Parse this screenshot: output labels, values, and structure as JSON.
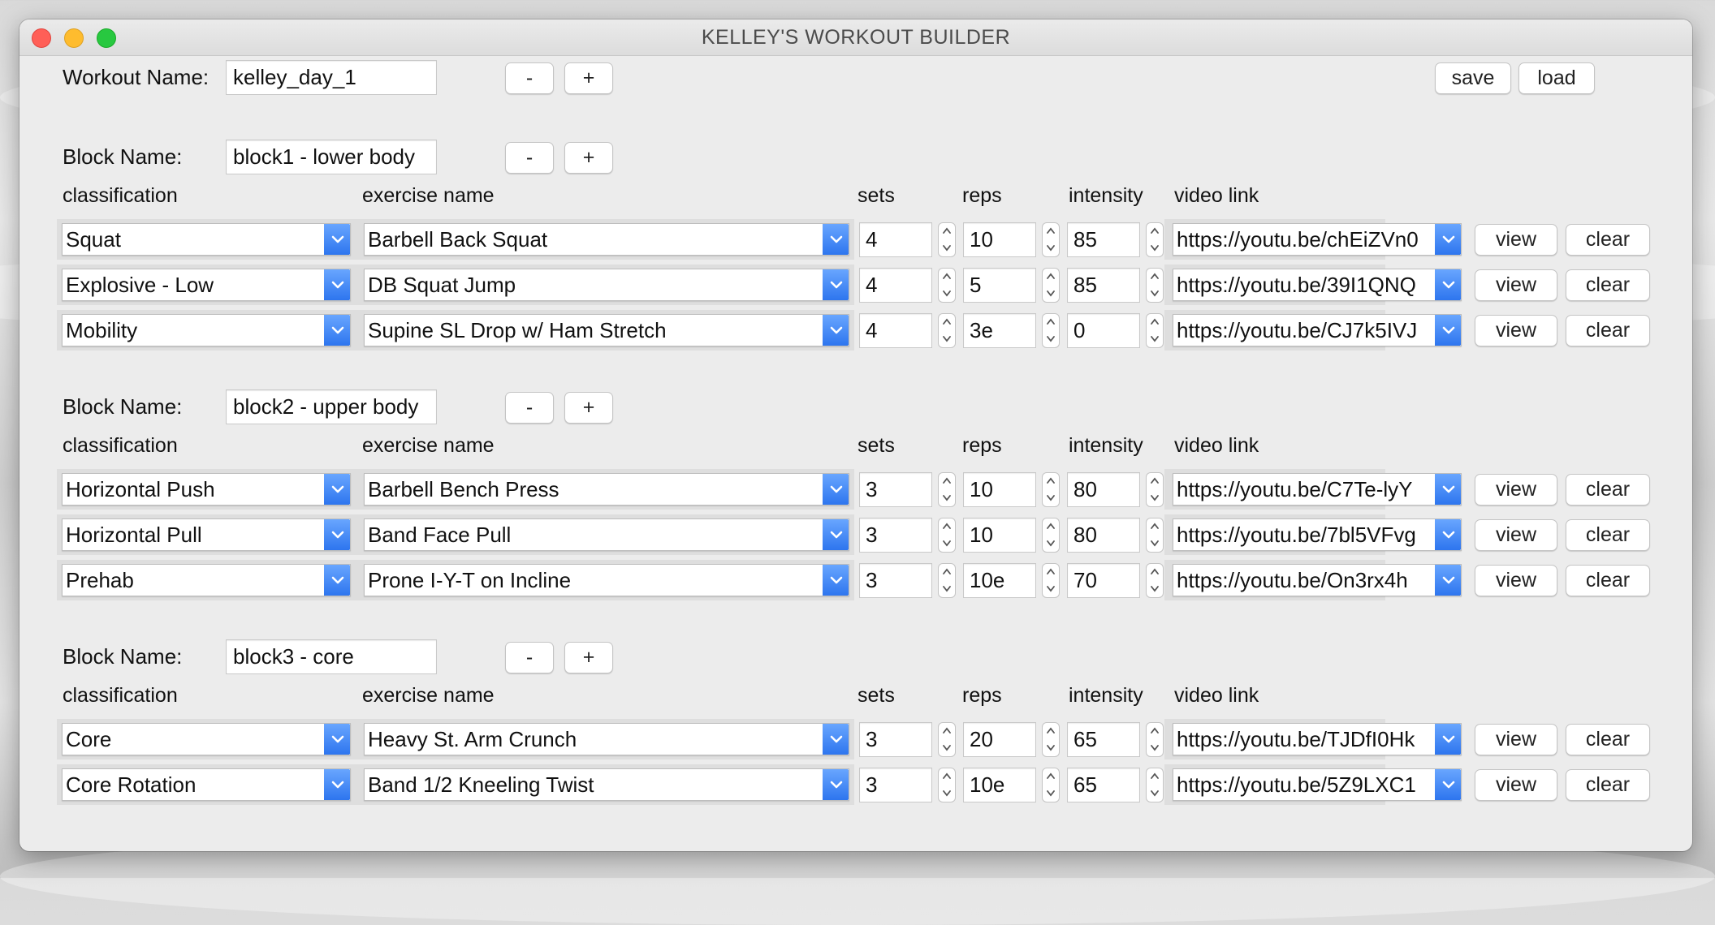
{
  "window": {
    "title": "KELLEY'S WORKOUT BUILDER"
  },
  "workout": {
    "label": "Workout Name:",
    "value": "kelley_day_1",
    "minus": "-",
    "plus": "+",
    "save": "save",
    "load": "load"
  },
  "columns": {
    "classification": "classification",
    "exercise": "exercise name",
    "sets": "sets",
    "reps": "reps",
    "intensity": "intensity",
    "video": "video link"
  },
  "row_buttons": {
    "view": "view",
    "clear": "clear"
  },
  "blocks": [
    {
      "label": "Block Name:",
      "name": "block1 - lower body",
      "minus": "-",
      "plus": "+",
      "rows": [
        {
          "classification": "Squat",
          "exercise": "Barbell Back Squat",
          "sets": "4",
          "reps": "10",
          "intensity": "85",
          "video": "https://youtu.be/chEiZVn0"
        },
        {
          "classification": "Explosive - Low",
          "exercise": "DB Squat Jump",
          "sets": "4",
          "reps": "5",
          "intensity": "85",
          "video": "https://youtu.be/39I1QNQ"
        },
        {
          "classification": "Mobility",
          "exercise": "Supine SL Drop w/ Ham Stretch",
          "sets": "4",
          "reps": "3e",
          "intensity": "0",
          "video": "https://youtu.be/CJ7k5IVJ"
        }
      ]
    },
    {
      "label": "Block Name:",
      "name": "block2 - upper body",
      "minus": "-",
      "plus": "+",
      "rows": [
        {
          "classification": "Horizontal Push",
          "exercise": "Barbell Bench Press",
          "sets": "3",
          "reps": "10",
          "intensity": "80",
          "video": "https://youtu.be/C7Te-lyY"
        },
        {
          "classification": "Horizontal Pull",
          "exercise": "Band Face Pull",
          "sets": "3",
          "reps": "10",
          "intensity": "80",
          "video": "https://youtu.be/7bl5VFvg"
        },
        {
          "classification": "Prehab",
          "exercise": "Prone I-Y-T on Incline",
          "sets": "3",
          "reps": "10e",
          "intensity": "70",
          "video": "https://youtu.be/On3rx4h"
        }
      ]
    },
    {
      "label": "Block Name:",
      "name": "block3 - core",
      "minus": "-",
      "plus": "+",
      "rows": [
        {
          "classification": "Core",
          "exercise": "Heavy St. Arm Crunch",
          "sets": "3",
          "reps": "20",
          "intensity": "65",
          "video": "https://youtu.be/TJDfI0Hk"
        },
        {
          "classification": "Core Rotation",
          "exercise": "Band 1/2 Kneeling Twist",
          "sets": "3",
          "reps": "10e",
          "intensity": "65",
          "video": "https://youtu.be/5Z9LXC1"
        }
      ]
    }
  ]
}
